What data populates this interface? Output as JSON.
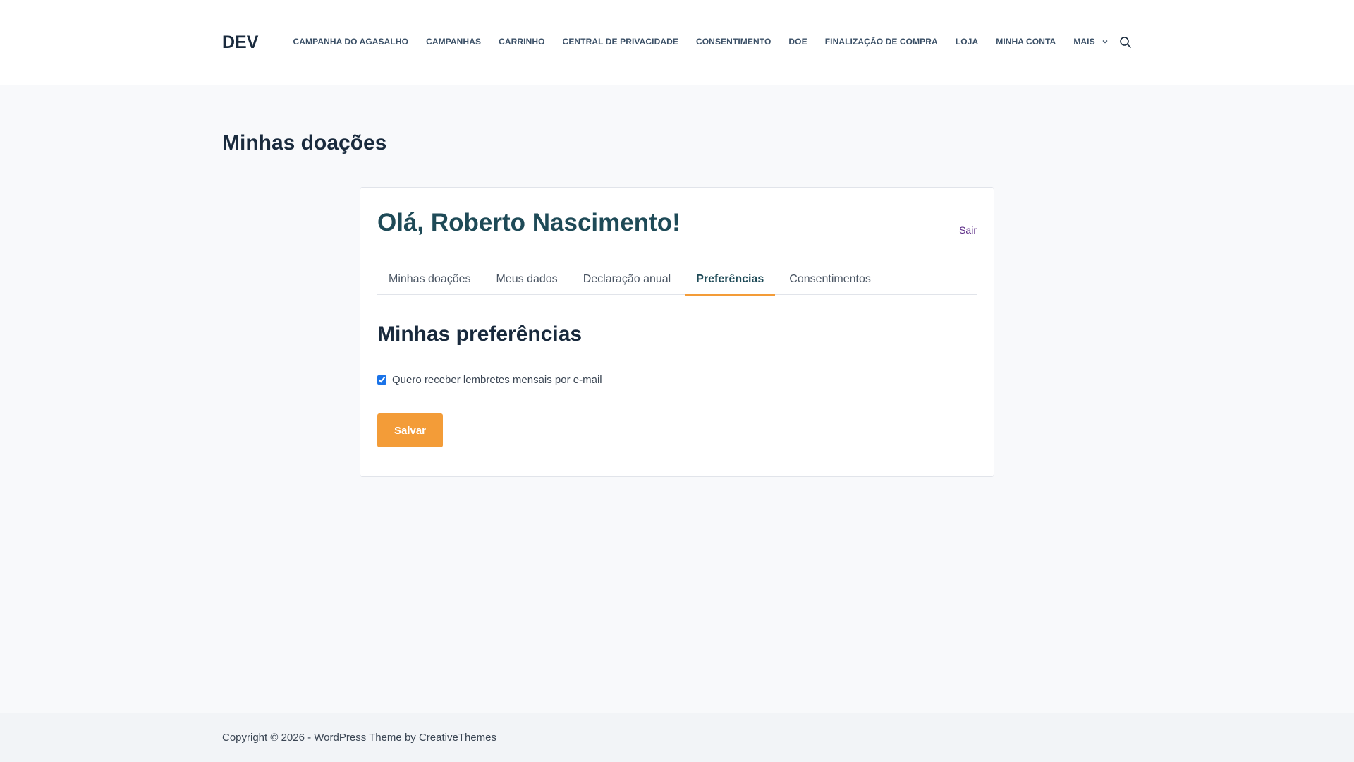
{
  "header": {
    "logo": "DEV",
    "nav": [
      "CAMPANHA DO AGASALHO",
      "CAMPANHAS",
      "CARRINHO",
      "CENTRAL DE PRIVACIDADE",
      "CONSENTIMENTO",
      "DOE",
      "FINALIZAÇÃO DE COMPRA",
      "LOJA",
      "MINHA CONTA"
    ],
    "more_label": "MAIS"
  },
  "page": {
    "title": "Minhas doações"
  },
  "account": {
    "greeting": "Olá, Roberto Nascimento!",
    "logout_label": "Sair",
    "tabs": [
      "Minhas doações",
      "Meus dados",
      "Declaração anual",
      "Preferências",
      "Consentimentos"
    ],
    "active_tab": "Preferências",
    "preferences": {
      "title": "Minhas preferências",
      "monthly_reminder_label": "Quero receber lembretes mensais por e-mail",
      "monthly_reminder_checked": true,
      "save_label": "Salvar"
    }
  },
  "footer": {
    "copyright": "Copyright © 2026 - WordPress Theme by CreativeThemes"
  },
  "colors": {
    "accent": "#f39c38",
    "heading": "#1e4a57",
    "logout_link": "#5b2a86"
  }
}
